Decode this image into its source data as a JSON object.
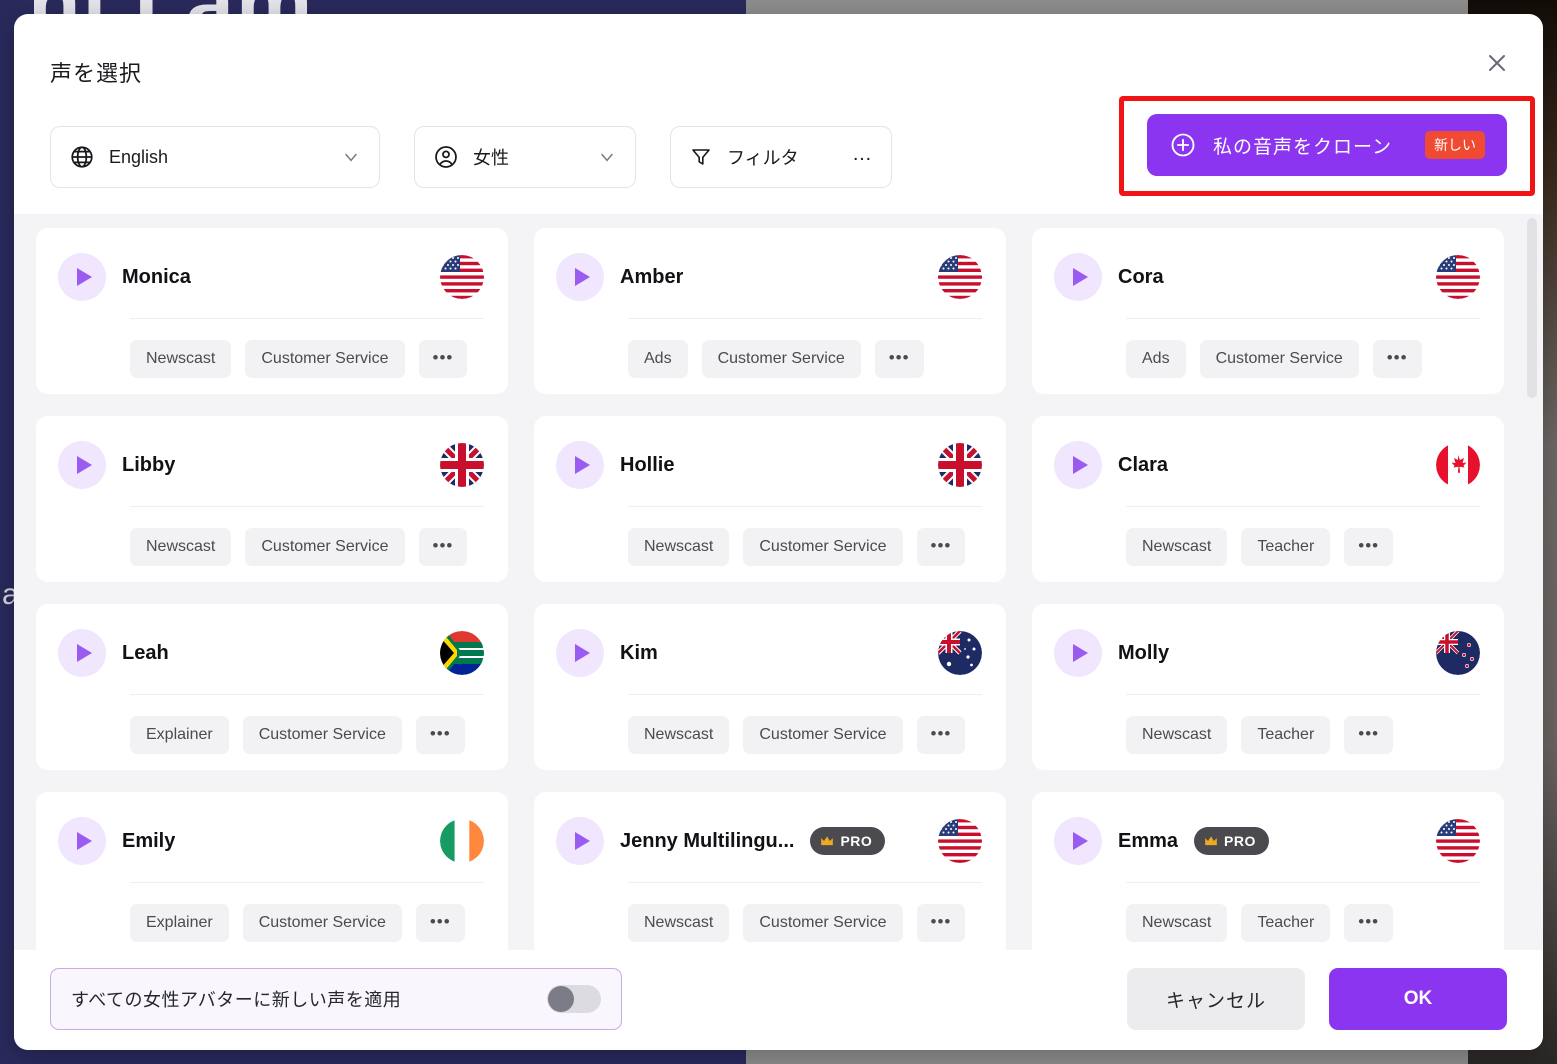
{
  "background": {
    "headline": "hi I am",
    "side_text": "a ( l e t"
  },
  "modal": {
    "title": "声を選択",
    "close_icon": "close-icon"
  },
  "filters": {
    "language": {
      "label": "English",
      "icon": "globe-icon",
      "chevron": "chevron-down-icon"
    },
    "gender": {
      "label": "女性",
      "icon": "person-icon",
      "chevron": "chevron-down-icon"
    },
    "filter": {
      "label": "フィルタ",
      "icon": "funnel-icon",
      "more": "…"
    }
  },
  "clone": {
    "label": "私の音声をクローン",
    "badge": "新しい",
    "icon": "plus-circle-icon",
    "highlight_color": "#f01414",
    "button_color": "#8b35f0"
  },
  "voices": [
    {
      "name": "Monica",
      "flag": "us",
      "pro": false,
      "tags": [
        "Newscast",
        "Customer Service"
      ]
    },
    {
      "name": "Amber",
      "flag": "us",
      "pro": false,
      "tags": [
        "Ads",
        "Customer Service"
      ]
    },
    {
      "name": "Cora",
      "flag": "us",
      "pro": false,
      "tags": [
        "Ads",
        "Customer Service"
      ]
    },
    {
      "name": "Libby",
      "flag": "gb",
      "pro": false,
      "tags": [
        "Newscast",
        "Customer Service"
      ]
    },
    {
      "name": "Hollie",
      "flag": "gb",
      "pro": false,
      "tags": [
        "Newscast",
        "Customer Service"
      ]
    },
    {
      "name": "Clara",
      "flag": "ca",
      "pro": false,
      "tags": [
        "Newscast",
        "Teacher"
      ]
    },
    {
      "name": "Leah",
      "flag": "za",
      "pro": false,
      "tags": [
        "Explainer",
        "Customer Service"
      ]
    },
    {
      "name": "Kim",
      "flag": "au",
      "pro": false,
      "tags": [
        "Newscast",
        "Customer Service"
      ]
    },
    {
      "name": "Molly",
      "flag": "nz",
      "pro": false,
      "tags": [
        "Newscast",
        "Teacher"
      ]
    },
    {
      "name": "Emily",
      "flag": "ie",
      "pro": false,
      "tags": [
        "Explainer",
        "Customer Service"
      ]
    },
    {
      "name": "Jenny Multilingu...",
      "flag": "us",
      "pro": true,
      "pro_label": "PRO",
      "tags": [
        "Newscast",
        "Customer Service"
      ]
    },
    {
      "name": "Emma",
      "flag": "us",
      "pro": true,
      "pro_label": "PRO",
      "tags": [
        "Newscast",
        "Teacher"
      ]
    }
  ],
  "card_more": "•••",
  "footer": {
    "apply_all_label": "すべての女性アバターに新しい声を適用",
    "toggle_on": false,
    "cancel_label": "キャンセル",
    "ok_label": "OK"
  }
}
